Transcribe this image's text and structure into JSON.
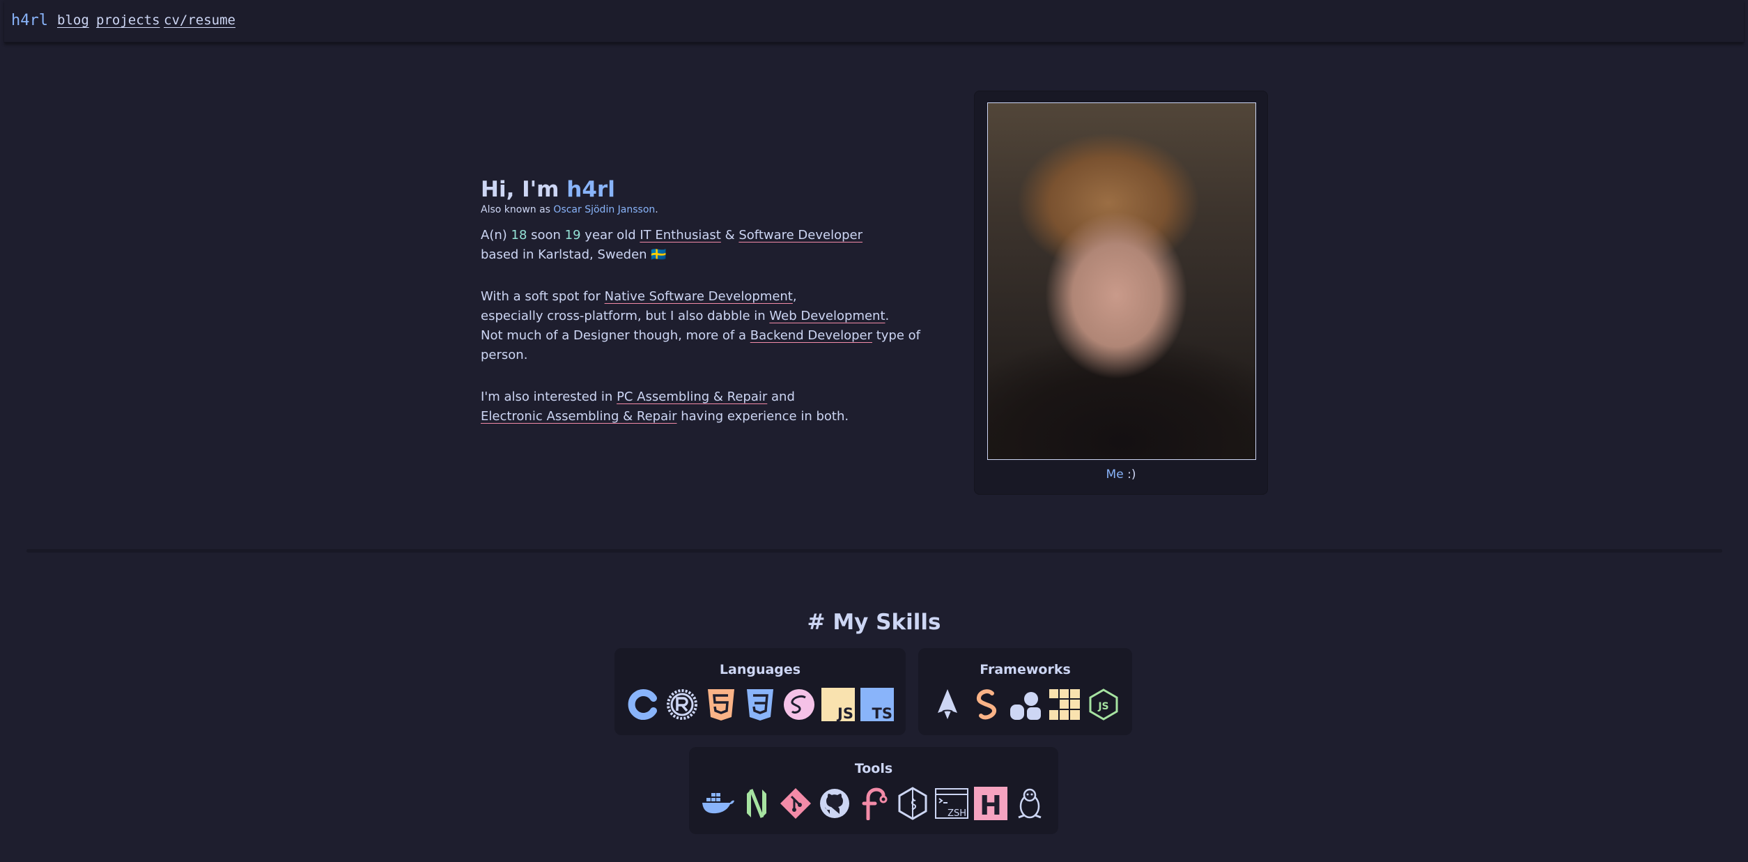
{
  "nav": {
    "brand": "h4rl",
    "links": [
      "blog",
      "projects",
      "cv/resume"
    ]
  },
  "intro": {
    "greeting": "Hi, I'm ",
    "name": "h4rl",
    "aka_prefix": "Also known as ",
    "full_name": "Oscar Sjödin Jansson",
    "aka_suffix": ".",
    "line1": {
      "a": "A(n) ",
      "age": "18",
      "b": " soon ",
      "next_age": "19",
      "c": " year old ",
      "role1": "IT Enthusiast",
      "amp": " & ",
      "role2": "Software Developer"
    },
    "line2": "based in Karlstad, Sweden 🇸🇪",
    "p2": {
      "a": "With a soft spot for ",
      "l1": "Native Software Development",
      "b": ",",
      "c": "especially cross-platform, but I also dabble in ",
      "l2": "Web Development",
      "d": ".",
      "e": "Not much of a Designer though, more of a ",
      "l3": "Backend Developer",
      "f": " type of person."
    },
    "p3": {
      "a": "I'm also interested in ",
      "l1": "PC Assembling & Repair",
      "b": " and",
      "l2": "Electronic Assembling & Repair",
      "c": " having experience in both."
    }
  },
  "photo": {
    "caption_a": "Me",
    "caption_b": " :)"
  },
  "skills": {
    "title": "# My Skills",
    "languages": {
      "title": "Languages",
      "icons": [
        "c-icon",
        "rust-icon",
        "html5-icon",
        "css3-icon",
        "sass-icon",
        "javascript-icon",
        "typescript-icon"
      ],
      "js_label": "JS",
      "ts_label": "TS"
    },
    "frameworks": {
      "title": "Frameworks",
      "icons": [
        "astro-icon",
        "svelte-icon",
        "bun-icon",
        "grid-framework-icon",
        "nodejs-icon"
      ],
      "node_label": "JS"
    },
    "tools": {
      "title": "Tools",
      "icons": [
        "docker-icon",
        "neovim-icon",
        "git-icon",
        "github-icon",
        "fish-shell-icon",
        "bash-icon",
        "zsh-icon",
        "hyprland-icon",
        "linux-tux-icon"
      ],
      "zsh_label": "ZSH",
      "h_label": "H"
    }
  },
  "colors": {
    "background": "#1e1e2e",
    "text": "#cdd6f4",
    "accent": "#89b4fa",
    "teal": "#94e2d5",
    "pink": "#f38ba8",
    "card": "#181825"
  }
}
